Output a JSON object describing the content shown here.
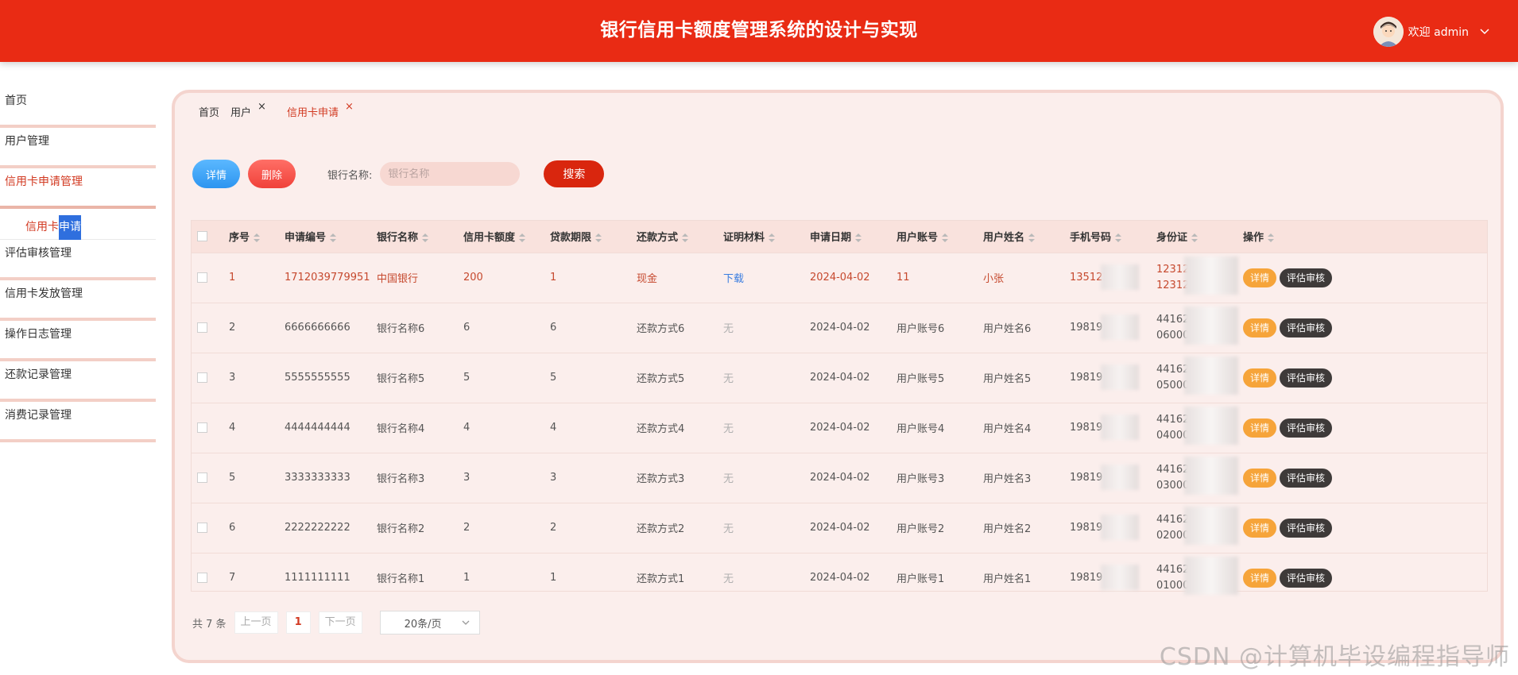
{
  "header": {
    "title": "银行信用卡额度管理系统的设计与实现",
    "welcome": "欢迎 admin"
  },
  "sidebar": {
    "items": [
      {
        "label": "首页"
      },
      {
        "label": "用户管理"
      },
      {
        "label": "信用卡申请管理"
      },
      {
        "label": "评估审核管理"
      },
      {
        "label": "信用卡发放管理"
      },
      {
        "label": "操作日志管理"
      },
      {
        "label": "还款记录管理"
      },
      {
        "label": "消费记录管理"
      }
    ],
    "sub_item": {
      "label_a": "信用卡",
      "label_b": "申请"
    }
  },
  "tabs": [
    {
      "label": "首页"
    },
    {
      "label": "用户"
    },
    {
      "label": "信用卡申请"
    }
  ],
  "tab_close_glyph": "×",
  "toolbar": {
    "detail_label": "详情",
    "delete_label": "删除",
    "search_label": "银行名称:",
    "search_placeholder": "银行名称",
    "search_button": "搜索"
  },
  "table": {
    "columns": [
      "序号",
      "申请编号",
      "银行名称",
      "信用卡额度",
      "贷款期限",
      "还款方式",
      "证明材料",
      "申请日期",
      "用户账号",
      "用户姓名",
      "手机号码",
      "身份证",
      "操作"
    ],
    "rows": [
      {
        "no": "1",
        "app_id": "1712039779951",
        "bank": "中国银行",
        "limit": "200",
        "term": "1",
        "repay": "现金",
        "proof": "下载",
        "date": "2024-04-02",
        "account": "11",
        "name": "小张",
        "phone": "135123",
        "id_a": "12312",
        "id_b": "12312"
      },
      {
        "no": "2",
        "app_id": "6666666666",
        "bank": "银行名称6",
        "limit": "6",
        "term": "6",
        "repay": "还款方式6",
        "proof": "无",
        "date": "2024-04-02",
        "account": "用户账号6",
        "name": "用户姓名6",
        "phone": "19819",
        "id_a": "44162",
        "id_b": "06000"
      },
      {
        "no": "3",
        "app_id": "5555555555",
        "bank": "银行名称5",
        "limit": "5",
        "term": "5",
        "repay": "还款方式5",
        "proof": "无",
        "date": "2024-04-02",
        "account": "用户账号5",
        "name": "用户姓名5",
        "phone": "19819",
        "id_a": "44162",
        "id_b": "05000"
      },
      {
        "no": "4",
        "app_id": "4444444444",
        "bank": "银行名称4",
        "limit": "4",
        "term": "4",
        "repay": "还款方式4",
        "proof": "无",
        "date": "2024-04-02",
        "account": "用户账号4",
        "name": "用户姓名4",
        "phone": "19819",
        "id_a": "44162",
        "id_b": "04000"
      },
      {
        "no": "5",
        "app_id": "3333333333",
        "bank": "银行名称3",
        "limit": "3",
        "term": "3",
        "repay": "还款方式3",
        "proof": "无",
        "date": "2024-04-02",
        "account": "用户账号3",
        "name": "用户姓名3",
        "phone": "19819",
        "id_a": "44162",
        "id_b": "03000"
      },
      {
        "no": "6",
        "app_id": "2222222222",
        "bank": "银行名称2",
        "limit": "2",
        "term": "2",
        "repay": "还款方式2",
        "proof": "无",
        "date": "2024-04-02",
        "account": "用户账号2",
        "name": "用户姓名2",
        "phone": "19819",
        "id_a": "44162",
        "id_b": "02000"
      },
      {
        "no": "7",
        "app_id": "1111111111",
        "bank": "银行名称1",
        "limit": "1",
        "term": "1",
        "repay": "还款方式1",
        "proof": "无",
        "date": "2024-04-02",
        "account": "用户账号1",
        "name": "用户姓名1",
        "phone": "19819",
        "id_a": "44162",
        "id_b": "01000"
      }
    ],
    "row_actions": {
      "detail": "详情",
      "evaluate": "评估审核"
    }
  },
  "pagination": {
    "total": "共 7 条",
    "prev": "上一页",
    "page": "1",
    "next": "下一页",
    "page_size": "20条/页"
  },
  "watermark": "CSDN @计算机毕设编程指导师",
  "colors": {
    "header": "#e92b14",
    "accent": "#d23a22",
    "panel_bg": "#fbeeec",
    "detail_blue": "#2d95f0",
    "delete_red": "#f0413a",
    "op_orange": "#f6a43a",
    "op_dark": "#3e3a39"
  }
}
